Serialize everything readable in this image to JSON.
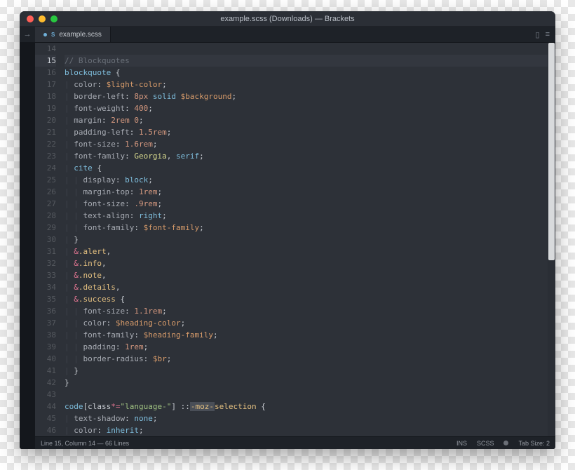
{
  "window": {
    "title": "example.scss (Downloads) — Brackets"
  },
  "tabs": [
    {
      "icon": "scss-file-icon",
      "label": "example.scss",
      "dirty": true,
      "active": true
    }
  ],
  "tabbar_actions": {
    "split": "split-icon",
    "menu": "menu-icon"
  },
  "gutter_start": 14,
  "active_line": 15,
  "code_lines": [
    {
      "n": 14,
      "text": ""
    },
    {
      "n": 15,
      "text": "// Blockquotes",
      "type": "comment"
    },
    {
      "n": 16,
      "raw": "blockquote {"
    },
    {
      "n": 17,
      "raw": "  color: $light-color;"
    },
    {
      "n": 18,
      "raw": "  border-left: 8px solid $background;"
    },
    {
      "n": 19,
      "raw": "  font-weight: 400;"
    },
    {
      "n": 20,
      "raw": "  margin: 2rem 0;"
    },
    {
      "n": 21,
      "raw": "  padding-left: 1.5rem;"
    },
    {
      "n": 22,
      "raw": "  font-size: 1.6rem;"
    },
    {
      "n": 23,
      "raw": "  font-family: Georgia, serif;"
    },
    {
      "n": 24,
      "raw": "  cite {"
    },
    {
      "n": 25,
      "raw": "    display: block;"
    },
    {
      "n": 26,
      "raw": "    margin-top: 1rem;"
    },
    {
      "n": 27,
      "raw": "    font-size: .9rem;"
    },
    {
      "n": 28,
      "raw": "    text-align: right;"
    },
    {
      "n": 29,
      "raw": "    font-family: $font-family;"
    },
    {
      "n": 30,
      "raw": "  }"
    },
    {
      "n": 31,
      "raw": "  &.alert,"
    },
    {
      "n": 32,
      "raw": "  &.info,"
    },
    {
      "n": 33,
      "raw": "  &.note,"
    },
    {
      "n": 34,
      "raw": "  &.details,"
    },
    {
      "n": 35,
      "raw": "  &.success {"
    },
    {
      "n": 36,
      "raw": "    font-size: 1.1rem;"
    },
    {
      "n": 37,
      "raw": "    color: $heading-color;"
    },
    {
      "n": 38,
      "raw": "    font-family: $heading-family;"
    },
    {
      "n": 39,
      "raw": "    padding: 1rem;"
    },
    {
      "n": 40,
      "raw": "    border-radius: $br;"
    },
    {
      "n": 41,
      "raw": "  }"
    },
    {
      "n": 42,
      "raw": "}"
    },
    {
      "n": 43,
      "raw": ""
    },
    {
      "n": 44,
      "raw": "code[class*=\"language-\"] ::-moz-selection {"
    },
    {
      "n": 45,
      "raw": "  text-shadow: none;"
    },
    {
      "n": 46,
      "raw": "  color: inherit;"
    }
  ],
  "statusbar": {
    "left": "Line 15, Column 14 — 66 Lines",
    "right": {
      "insert_mode": "INS",
      "language": "SCSS",
      "tab_size": "Tab Size: 2"
    }
  }
}
